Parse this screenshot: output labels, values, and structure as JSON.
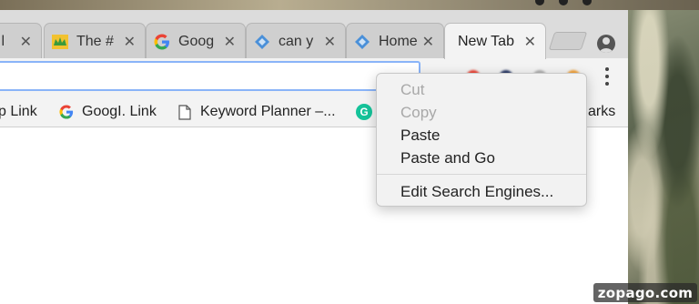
{
  "tabs": [
    {
      "label": "s l",
      "icon": "page-icon"
    },
    {
      "label": "The #",
      "icon": "crown-icon"
    },
    {
      "label": "Goog",
      "icon": "google-g-icon"
    },
    {
      "label": "can y",
      "icon": "diamond-icon"
    },
    {
      "label": "Home",
      "icon": "diamond-icon"
    },
    {
      "label": "New Tab",
      "icon": "none",
      "active": true
    }
  ],
  "tab_close_glyph": "✕",
  "bookmarks": [
    {
      "label": "p Link",
      "icon": "none"
    },
    {
      "label": "GoogI. Link",
      "icon": "google-g-icon"
    },
    {
      "label": "Keyword Planner –...",
      "icon": "page-icon"
    },
    {
      "label": "",
      "icon": "grammarly-icon"
    },
    {
      "label": "arks",
      "icon": "none"
    }
  ],
  "context_menu": {
    "items": [
      {
        "label": "Cut",
        "disabled": true
      },
      {
        "label": "Copy",
        "disabled": true
      },
      {
        "label": "Paste",
        "disabled": false
      },
      {
        "label": "Paste and Go",
        "disabled": false
      },
      {
        "label": "Edit Search Engines...",
        "disabled": false
      }
    ]
  },
  "watermark": "zopago.com",
  "colors": {
    "omnibox_focus": "#8ab4f8",
    "google_blue": "#4285f4",
    "google_red": "#ea4335",
    "google_yellow": "#fbbc05",
    "google_green": "#34a853",
    "grammarly_green": "#15c39a"
  }
}
